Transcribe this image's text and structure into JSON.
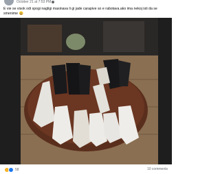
{
  "post": {
    "timestamp": "October 21 at 7:53 PM",
    "text": "E vie se visok odi spogi nagligi masinava li gi jade carapive so e rabotava.ako ima nekoj isti da se smenime",
    "emoji": "😄"
  },
  "photo": {
    "description_icon": "photo-of-socks"
  },
  "footer": {
    "reaction_count": "58",
    "comments_label": "10 comments"
  },
  "colors": {
    "meta_text": "#65676b",
    "like_blue": "#1877f2",
    "haha_yellow": "#f7b125"
  }
}
